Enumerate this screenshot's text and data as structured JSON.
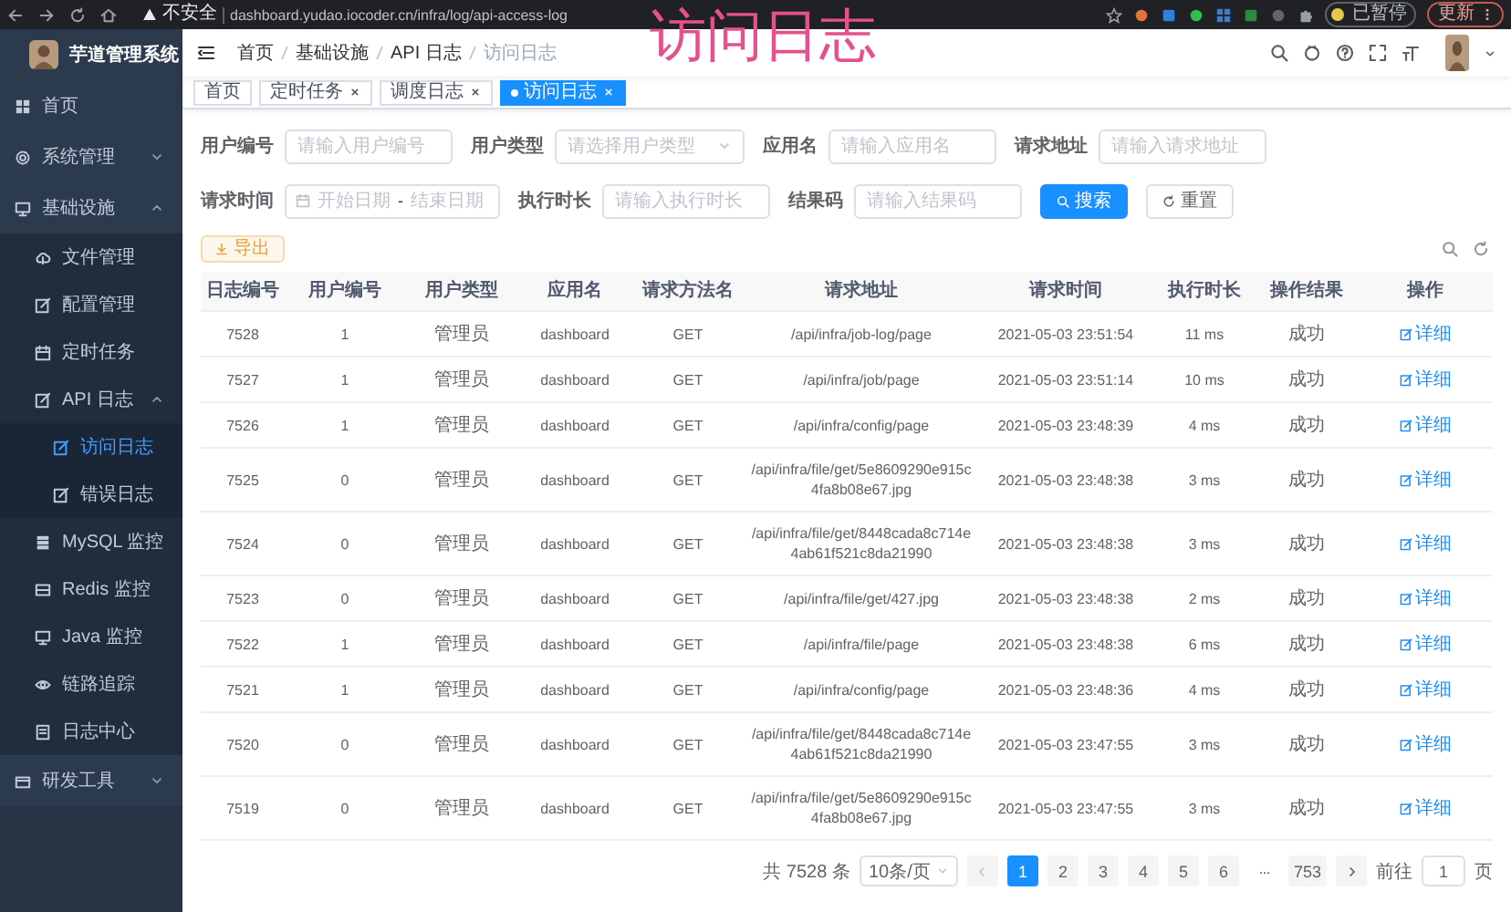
{
  "browser": {
    "security_label": "不安全",
    "url": "dashboard.yudao.iocoder.cn/infra/log/api-access-log",
    "profile_label": "已暂停",
    "update_label": "更新"
  },
  "overlay_title": "访问日志",
  "sidebar": {
    "app_title": "芋道管理系统",
    "items": [
      {
        "label": "首页",
        "selected": false
      },
      {
        "label": "系统管理",
        "selected": false,
        "expanded": false
      },
      {
        "label": "基础设施",
        "selected": false,
        "expanded": true,
        "children": [
          {
            "label": "文件管理",
            "selected": false
          },
          {
            "label": "配置管理",
            "selected": false
          },
          {
            "label": "定时任务",
            "selected": false
          },
          {
            "label": "API 日志",
            "selected": false,
            "expanded": true,
            "children": [
              {
                "label": "访问日志",
                "selected": true
              },
              {
                "label": "错误日志",
                "selected": false
              }
            ]
          },
          {
            "label": "MySQL 监控",
            "selected": false
          },
          {
            "label": "Redis 监控",
            "selected": false
          },
          {
            "label": "Java 监控",
            "selected": false
          },
          {
            "label": "链路追踪",
            "selected": false
          },
          {
            "label": "日志中心",
            "selected": false
          }
        ]
      },
      {
        "label": "研发工具",
        "selected": false,
        "expanded": false
      }
    ]
  },
  "breadcrumb": [
    "首页",
    "基础设施",
    "API 日志",
    "访问日志"
  ],
  "tags": [
    {
      "label": "首页",
      "selected": false,
      "closable": false
    },
    {
      "label": "定时任务",
      "selected": false,
      "closable": true
    },
    {
      "label": "调度日志",
      "selected": false,
      "closable": true
    },
    {
      "label": "访问日志",
      "selected": true,
      "closable": true
    }
  ],
  "filters": {
    "rows": [
      [
        {
          "kind": "input",
          "label": "用户编号",
          "placeholder": "请输入用户编号"
        },
        {
          "kind": "select",
          "label": "用户类型",
          "placeholder": "请选择用户类型"
        },
        {
          "kind": "input",
          "label": "应用名",
          "placeholder": "请输入应用名"
        },
        {
          "kind": "input",
          "label": "请求地址",
          "placeholder": "请输入请求地址"
        }
      ],
      [
        {
          "kind": "daterange",
          "label": "请求时间",
          "start_placeholder": "开始日期",
          "separator": "-",
          "end_placeholder": "结束日期"
        },
        {
          "kind": "input",
          "label": "执行时长",
          "placeholder": "请输入执行时长"
        },
        {
          "kind": "input",
          "label": "结果码",
          "placeholder": "请输入结果码"
        }
      ]
    ],
    "buttons": [
      {
        "kind": "primary",
        "label": "搜索"
      },
      {
        "kind": "plain",
        "label": "重置"
      }
    ]
  },
  "export_button": "导出",
  "table": {
    "columns": [
      {
        "label": "日志编号",
        "kind": "text"
      },
      {
        "label": "用户编号",
        "kind": "text"
      },
      {
        "label": "用户类型",
        "kind": "text"
      },
      {
        "label": "应用名",
        "kind": "text"
      },
      {
        "label": "请求方法名",
        "kind": "text"
      },
      {
        "label": "请求地址",
        "kind": "text"
      },
      {
        "label": "请求时间",
        "kind": "text"
      },
      {
        "label": "执行时长",
        "kind": "text"
      },
      {
        "label": "操作结果",
        "kind": "text"
      },
      {
        "label": "操作",
        "kind": "action"
      }
    ],
    "rows": [
      [
        "7528",
        "1",
        "管理员",
        "dashboard",
        "GET",
        "/api/infra/job-log/page",
        "2021-05-03 23:51:54",
        "11 ms",
        "成功",
        "详细"
      ],
      [
        "7527",
        "1",
        "管理员",
        "dashboard",
        "GET",
        "/api/infra/job/page",
        "2021-05-03 23:51:14",
        "10 ms",
        "成功",
        "详细"
      ],
      [
        "7526",
        "1",
        "管理员",
        "dashboard",
        "GET",
        "/api/infra/config/page",
        "2021-05-03 23:48:39",
        "4 ms",
        "成功",
        "详细"
      ],
      [
        "7525",
        "0",
        "管理员",
        "dashboard",
        "GET",
        "/api/infra/file/get/5e8609290e915c4fa8b08e67.jpg",
        "2021-05-03 23:48:38",
        "3 ms",
        "成功",
        "详细"
      ],
      [
        "7524",
        "0",
        "管理员",
        "dashboard",
        "GET",
        "/api/infra/file/get/8448cada8c714e4ab61f521c8da21990",
        "2021-05-03 23:48:38",
        "3 ms",
        "成功",
        "详细"
      ],
      [
        "7523",
        "0",
        "管理员",
        "dashboard",
        "GET",
        "/api/infra/file/get/427.jpg",
        "2021-05-03 23:48:38",
        "2 ms",
        "成功",
        "详细"
      ],
      [
        "7522",
        "1",
        "管理员",
        "dashboard",
        "GET",
        "/api/infra/file/page",
        "2021-05-03 23:48:38",
        "6 ms",
        "成功",
        "详细"
      ],
      [
        "7521",
        "1",
        "管理员",
        "dashboard",
        "GET",
        "/api/infra/config/page",
        "2021-05-03 23:48:36",
        "4 ms",
        "成功",
        "详细"
      ],
      [
        "7520",
        "0",
        "管理员",
        "dashboard",
        "GET",
        "/api/infra/file/get/8448cada8c714e4ab61f521c8da21990",
        "2021-05-03 23:47:55",
        "3 ms",
        "成功",
        "详细"
      ],
      [
        "7519",
        "0",
        "管理员",
        "dashboard",
        "GET",
        "/api/infra/file/get/5e8609290e915c4fa8b08e67.jpg",
        "2021-05-03 23:47:55",
        "3 ms",
        "成功",
        "详细"
      ]
    ]
  },
  "pagination": {
    "total": "共 7528 条",
    "page_size": "10条/页",
    "pages": [
      {
        "label": "1",
        "kind": "page",
        "selected": true
      },
      {
        "label": "2",
        "kind": "page",
        "selected": false
      },
      {
        "label": "3",
        "kind": "page",
        "selected": false
      },
      {
        "label": "4",
        "kind": "page",
        "selected": false
      },
      {
        "label": "5",
        "kind": "page",
        "selected": false
      },
      {
        "label": "6",
        "kind": "page",
        "selected": false
      },
      {
        "label": "···",
        "kind": "more",
        "selected": false
      },
      {
        "label": "753",
        "kind": "page",
        "selected": false
      }
    ],
    "goto_label": "前往",
    "goto_value": "1",
    "goto_suffix": "页"
  }
}
